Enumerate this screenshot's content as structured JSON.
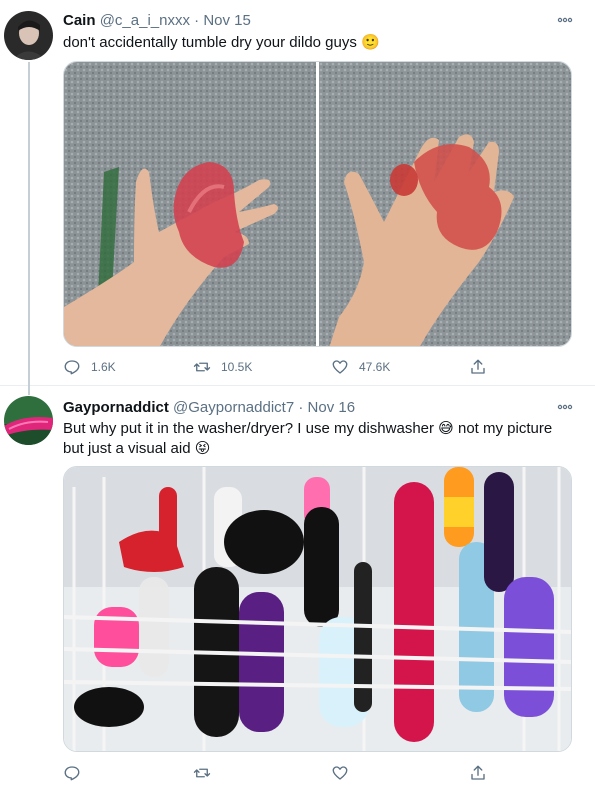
{
  "tweets": [
    {
      "author_name": "Cain",
      "handle": "@c_a_i_nxxx",
      "separator": "·",
      "date": "Nov 15",
      "text": "don't accidentally tumble dry your dildo guys 🙂",
      "more_icon": "more-dots-icon",
      "actions": {
        "reply_count": "1.6K",
        "retweet_count": "10.5K",
        "like_count": "47.6K"
      }
    },
    {
      "author_name": "Gaypornaddict",
      "handle": "@Gaypornaddict7",
      "separator": "·",
      "date": "Nov 16",
      "text_line1": "But why put it in the washer/dryer? I use my dishwasher 😅 not my picture",
      "text_line2": "but just a visual aid 😝",
      "more_icon": "more-dots-icon",
      "actions": {
        "reply_count": "",
        "retweet_count": "",
        "like_count": ""
      }
    }
  ],
  "colors": {
    "secondary_text": "#5b7083",
    "thread_line": "#c4cfd6",
    "divider": "#ebeef0"
  }
}
